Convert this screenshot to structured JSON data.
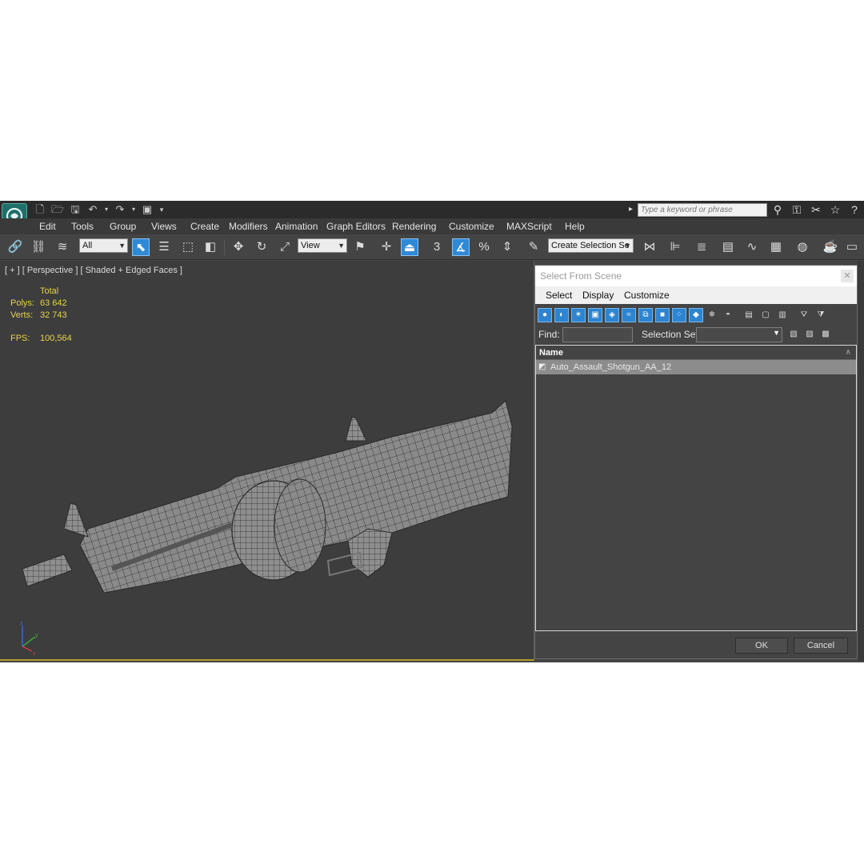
{
  "window": {
    "search_placeholder": "Type a keyword or phrase"
  },
  "menubar": {
    "items": [
      "Edit",
      "Tools",
      "Group",
      "Views",
      "Create",
      "Modifiers",
      "Animation",
      "Graph Editors",
      "Rendering",
      "Customize",
      "MAXScript",
      "Help"
    ]
  },
  "toolbar": {
    "selection_filter": "All",
    "reference_coord": "View",
    "named_selection_set": "Create Selection Se",
    "snap_toggle": "3"
  },
  "viewport": {
    "label": "[ + ] [ Perspective ] [ Shaded + Edged Faces ]",
    "stats": {
      "header": "Total",
      "polys_label": "Polys:",
      "polys_value": "63 642",
      "verts_label": "Verts:",
      "verts_value": "32 743",
      "fps_label": "FPS:",
      "fps_value": "100,564"
    },
    "axis": {
      "z": "z",
      "y": "y",
      "x": "x"
    }
  },
  "dialog": {
    "title": "Select From Scene",
    "menu": [
      "Select",
      "Display",
      "Customize"
    ],
    "find_label": "Find:",
    "selection_set_label": "Selection Set:",
    "column_name": "Name",
    "rows": [
      "Auto_Assault_Shotgun_AA_12"
    ],
    "ok_label": "OK",
    "cancel_label": "Cancel"
  },
  "colors": {
    "stats_text": "#e6d24a",
    "active_button": "#2f8ad6",
    "viewport_bg": "#3d3d3d",
    "active_viewport_border": "#b59a2f"
  }
}
